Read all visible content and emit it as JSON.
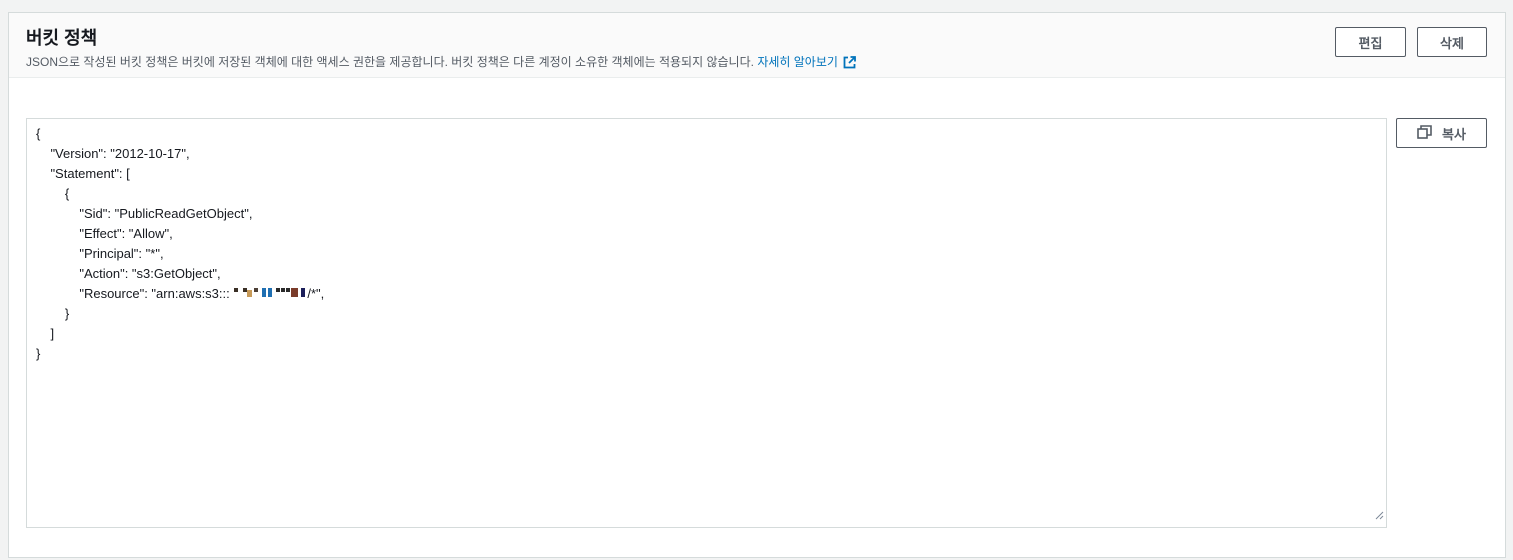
{
  "panel": {
    "title": "버킷 정책",
    "description": "JSON으로 작성된 버킷 정책은 버킷에 저장된 객체에 대한 액세스 권한을 제공합니다. 버킷 정책은 다른 계정이 소유한 객체에는 적용되지 않습니다.",
    "learn_more_link": "자세히 알아보기",
    "learn_more_icon": "external-link-icon"
  },
  "buttons": {
    "edit_label": "편집",
    "delete_label": "삭제",
    "copy_label": "복사",
    "copy_icon": "copy-icon"
  },
  "policy": {
    "lines": [
      "{",
      "    \"Version\": \"2012-10-17\",",
      "    \"Statement\": [",
      "        {",
      "            \"Sid\": \"PublicReadGetObject\",",
      "            \"Effect\": \"Allow\",",
      "            \"Principal\": \"*\",",
      "            \"Action\": \"s3:GetObject\",",
      "            \"Resource\": \"arn:aws:s3::: ",
      "        }",
      "    ]",
      "}"
    ],
    "resource_suffix": "/*\",",
    "redacted_bucket_name_colors": [
      "#3a2f25",
      "#c79a58",
      "#4d4037",
      "#1f6fb2",
      "#2a2a2a",
      "#7a3b2a",
      "#1b1e5a"
    ]
  },
  "colors": {
    "link": "#0073bb",
    "button_border": "#545b64",
    "panel_border": "#d5dbdb",
    "background": "#f2f3f3"
  }
}
